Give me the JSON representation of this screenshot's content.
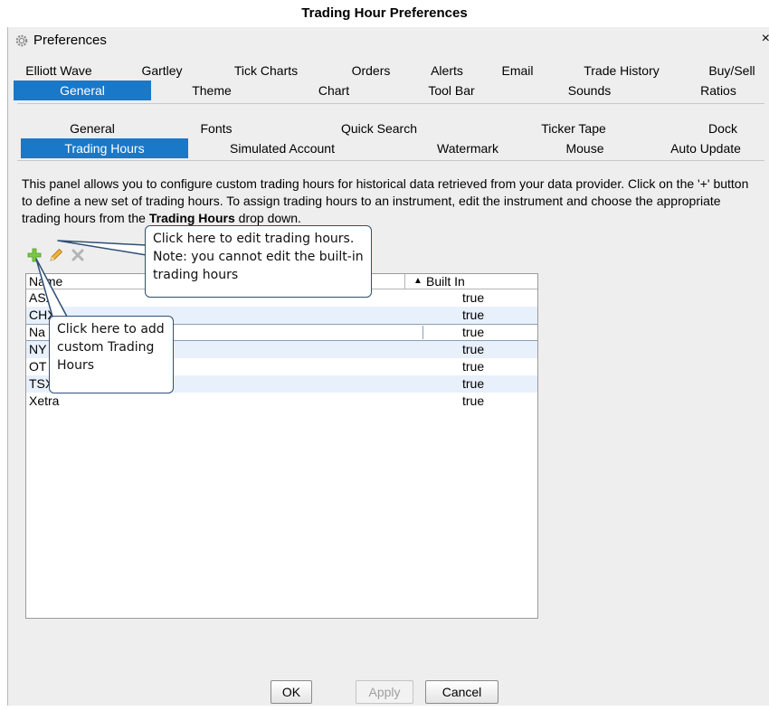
{
  "doc_title": "Trading Hour Preferences",
  "window": {
    "title": "Preferences",
    "close_glyph": "×"
  },
  "tabs_row1": [
    "Elliott Wave",
    "Gartley",
    "Tick Charts",
    "Orders",
    "Alerts",
    "Email",
    "Trade History",
    "Buy/Sell"
  ],
  "tabs_row2": [
    "General",
    "Theme",
    "Chart",
    "Tool Bar",
    "Sounds",
    "Ratios"
  ],
  "subtabs_row1": [
    "General",
    "Fonts",
    "Quick Search",
    "Ticker Tape",
    "Dock"
  ],
  "subtabs_row2": [
    "Trading Hours",
    "Simulated Account",
    "Watermark",
    "Mouse",
    "Auto Update"
  ],
  "description": {
    "part1": "This panel allows you to configure custom trading hours for historical data retrieved from your data provider. Click on the '+' button to define a new set of trading hours. To assign trading hours to an instrument, edit the instrument and choose the appropriate trading hours from the ",
    "bold": "Trading Hours",
    "part2": " drop down."
  },
  "toolbar": {
    "add_icon": "plus-icon",
    "edit_icon": "pencil-icon",
    "delete_icon": "x-icon"
  },
  "table": {
    "columns": [
      "Name",
      "Built In"
    ],
    "sort_glyph": "▲",
    "rows": [
      {
        "name": "ASX",
        "built_in": "true"
      },
      {
        "name": "CHX",
        "built_in": "true"
      },
      {
        "name": "Na",
        "built_in": "true"
      },
      {
        "name": "NY",
        "built_in": "true"
      },
      {
        "name": "OT",
        "built_in": "true"
      },
      {
        "name": "TSX",
        "built_in": "true"
      },
      {
        "name": "Xetra",
        "built_in": "true"
      }
    ]
  },
  "buttons": {
    "ok": "OK",
    "apply": "Apply",
    "cancel": "Cancel"
  },
  "callouts": {
    "edit": "Click here to edit trading hours. Note: you cannot edit the built-in trading hours",
    "add": "Click here to add custom Trading Hours"
  },
  "colors": {
    "selected_tab": "#1a78c8",
    "alt_row": "#e8f0fb",
    "callout_border": "#2f4f74"
  }
}
